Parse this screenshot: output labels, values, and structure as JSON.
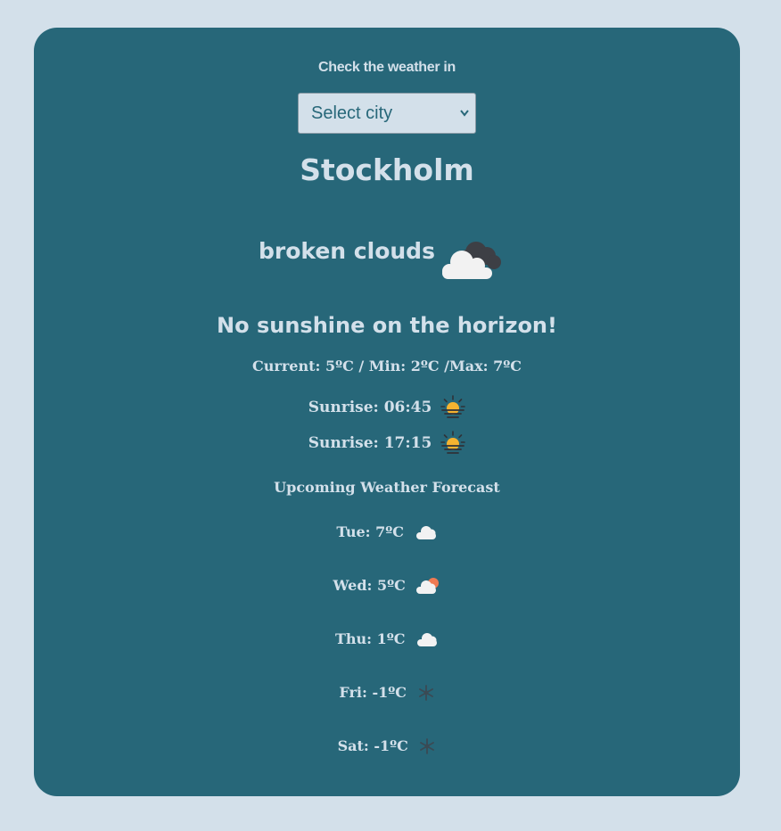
{
  "prompt": "Check the weather in",
  "city_select": {
    "selected": "Select city"
  },
  "city": "Stockholm",
  "current": {
    "description": "broken clouds",
    "icon": "broken-clouds-icon",
    "slogan": "No sunshine on the horizon!",
    "temps": "Current: 5ºC / Min: 2ºC /Max: 7ºC"
  },
  "sun": {
    "sunrise": "Sunrise: 06:45",
    "sunset": "Sunrise: 17:15",
    "icon": "sunrise-icon"
  },
  "forecast": {
    "title": "Upcoming Weather Forecast",
    "days": [
      {
        "label": "Tue: 7ºC",
        "icon": "cloud-icon"
      },
      {
        "label": "Wed: 5ºC",
        "icon": "cloud-sun-icon"
      },
      {
        "label": "Thu: 1ºC",
        "icon": "cloud-icon"
      },
      {
        "label": "Fri: -1ºC",
        "icon": "snowflake-icon"
      },
      {
        "label": "Sat: -1ºC",
        "icon": "snowflake-icon"
      }
    ]
  },
  "colors": {
    "page_bg": "#d3e0ea",
    "card_bg": "#276779",
    "text": "#d3e0ea",
    "sun": "#f5b330",
    "dark_cloud": "#3d3f45"
  }
}
